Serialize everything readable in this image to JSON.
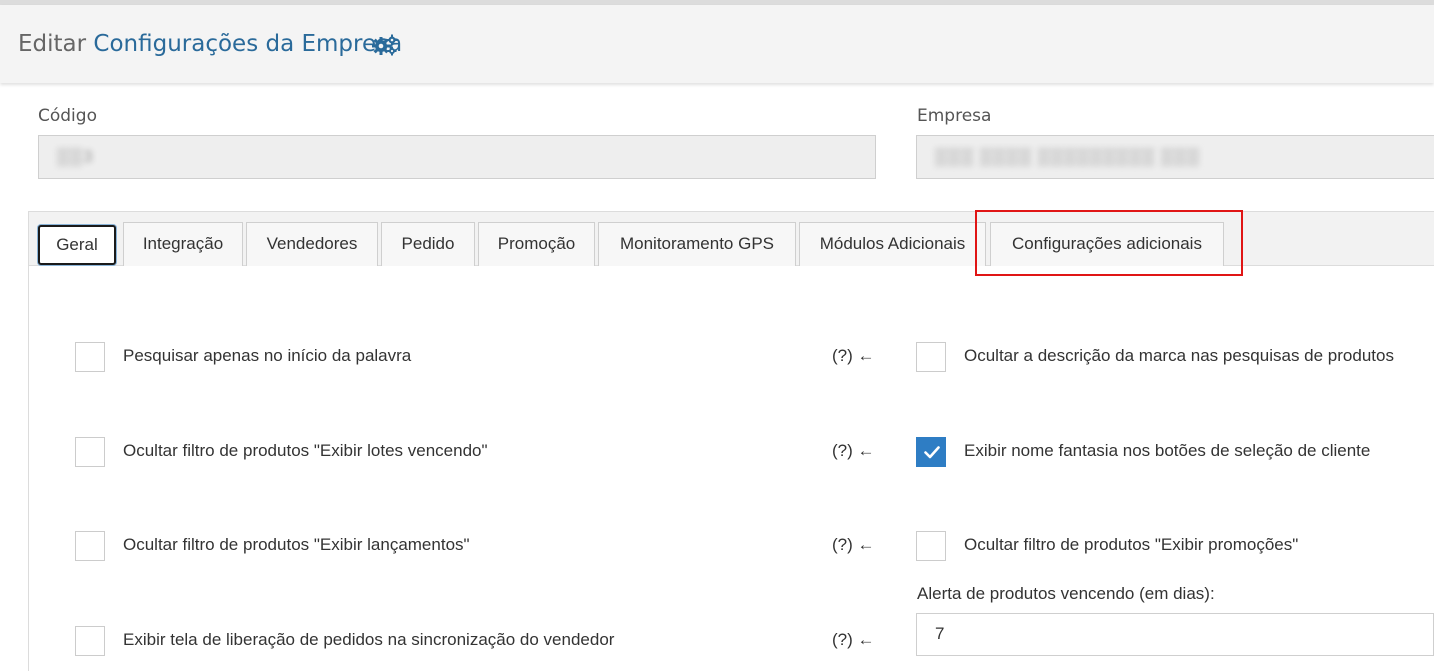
{
  "header": {
    "title_prefix": "Editar ",
    "title_main": "Configurações da Empresa",
    "icon": "gears-icon"
  },
  "fields": {
    "codigo_label": "Código",
    "codigo_value": "▒▒3",
    "empresa_label": "Empresa",
    "empresa_value": "▒▒▒ ▒▒▒▒ ▒▒▒▒▒▒▒▒▒ ▒▒▒"
  },
  "tabs": [
    {
      "label": "Geral",
      "active": true
    },
    {
      "label": "Integração"
    },
    {
      "label": "Vendedores"
    },
    {
      "label": "Pedido"
    },
    {
      "label": "Promoção"
    },
    {
      "label": "Monitoramento GPS"
    },
    {
      "label": "Módulos Adicionais"
    },
    {
      "label": "Configurações adicionais",
      "highlighted": true
    }
  ],
  "left_options": [
    {
      "label": "Pesquisar apenas no início da palavra",
      "checked": false,
      "help": "(?) ←"
    },
    {
      "label": "Ocultar filtro de produtos \"Exibir lotes vencendo\"",
      "checked": false,
      "help": "(?) ←"
    },
    {
      "label": "Ocultar filtro de produtos \"Exibir lançamentos\"",
      "checked": false,
      "help": "(?) ←"
    },
    {
      "label": "Exibir tela de liberação de pedidos na sincronização do vendedor",
      "checked": false,
      "help": "(?) ←"
    }
  ],
  "right_options": [
    {
      "label": "Ocultar a descrição da marca nas pesquisas de produtos",
      "checked": false
    },
    {
      "label": "Exibir nome fantasia nos botões de seleção de cliente",
      "checked": true
    },
    {
      "label": "Ocultar filtro de produtos \"Exibir promoções\"",
      "checked": false
    }
  ],
  "alert": {
    "label": "Alerta de produtos vencendo (em dias):",
    "value": "7"
  },
  "colors": {
    "accent": "#2a6a9a",
    "checkbox_checked": "#2e7dc4",
    "highlight": "#e01515"
  }
}
